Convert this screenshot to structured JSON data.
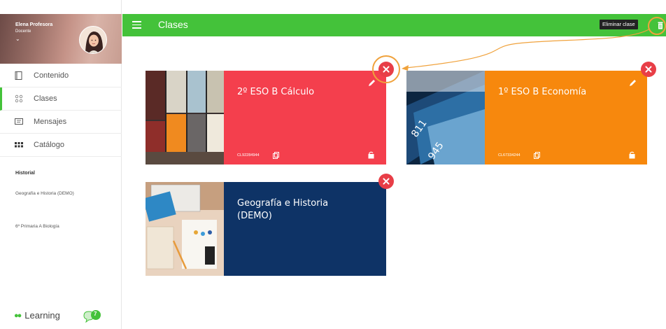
{
  "sidebar": {
    "user_name": "Elena Profesora",
    "user_role": "Docente",
    "nav": [
      {
        "label": "Contenido",
        "icon": "book-icon"
      },
      {
        "label": "Clases",
        "icon": "group-icon"
      },
      {
        "label": "Mensajes",
        "icon": "message-icon"
      },
      {
        "label": "Catálogo",
        "icon": "grid-icon"
      }
    ],
    "history_title": "Historial",
    "history": [
      "Geografía e Historia (DEMO)",
      "6º Primaria A Biología"
    ],
    "brand": "Learning",
    "chat_badge": "7"
  },
  "topbar": {
    "title": "Clases",
    "tooltip": "Eliminar clase"
  },
  "cards": [
    {
      "title": "2º ESO B Cálculo",
      "code": "CL92284944",
      "color": "#f43f4d"
    },
    {
      "title": "1º ESO B Economía",
      "code": "CL67334244",
      "color": "#f7880d"
    },
    {
      "title": "Geografía e Historia (DEMO)",
      "code": "",
      "color": "#0e3366"
    }
  ],
  "colors": {
    "accent": "#44c23a",
    "delete": "#e83e47",
    "highlight": "#f0a23c"
  }
}
